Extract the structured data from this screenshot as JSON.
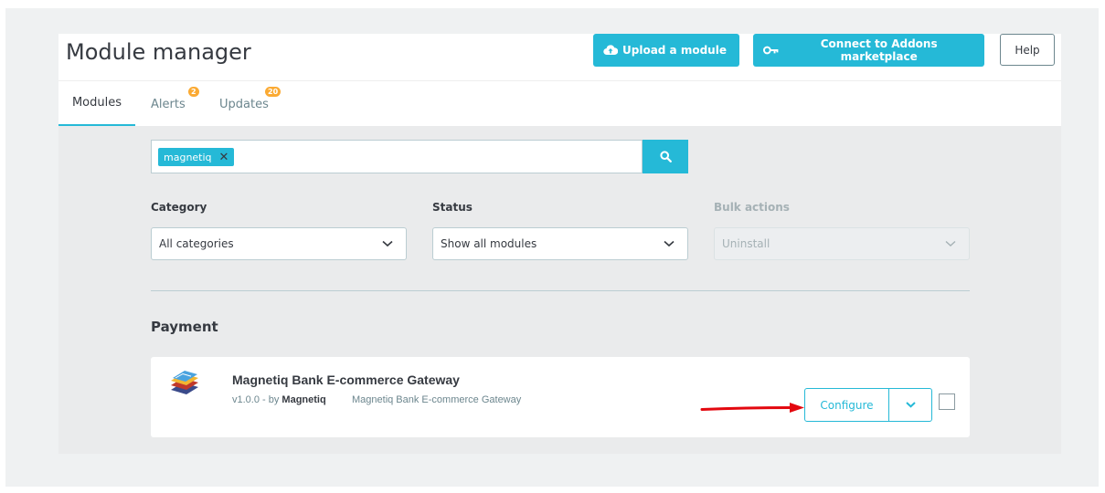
{
  "header": {
    "title": "Module manager",
    "upload_label": "Upload a module",
    "addons_label": "Connect to Addons marketplace",
    "help_label": "Help"
  },
  "tabs": [
    {
      "label": "Modules",
      "active": true
    },
    {
      "label": "Alerts",
      "badge": "2"
    },
    {
      "label": "Updates",
      "badge": "20"
    }
  ],
  "search": {
    "tag": "magnetiq",
    "tag_close": "✕"
  },
  "filters": {
    "category_label": "Category",
    "category_value": "All categories",
    "status_label": "Status",
    "status_value": "Show all modules",
    "bulk_label": "Bulk actions",
    "bulk_value": "Uninstall"
  },
  "section": {
    "title": "Payment"
  },
  "module": {
    "name": "Magnetiq Bank E-commerce Gateway",
    "version": "v1.0.0 - by",
    "author": "Magnetiq",
    "description": "Magnetiq Bank E-commerce Gateway",
    "configure_label": "Configure"
  },
  "colors": {
    "accent": "#25b9d7",
    "badge": "#fbaa33",
    "annotation_arrow": "#e3080f"
  }
}
